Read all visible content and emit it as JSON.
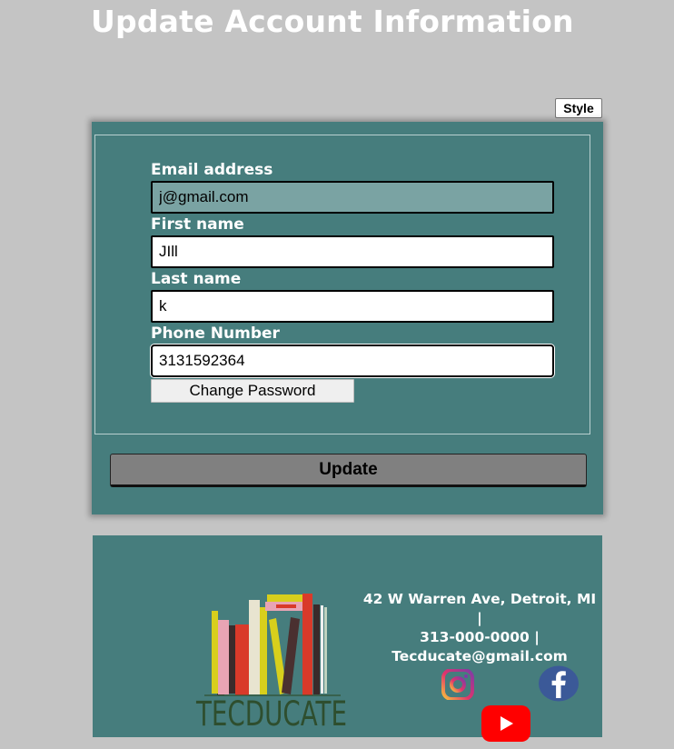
{
  "page": {
    "title": "Update Account Information"
  },
  "toolbar": {
    "style_label": "Style"
  },
  "form": {
    "email": {
      "label": "Email address",
      "value": "j@gmail.com"
    },
    "first_name": {
      "label": "First name",
      "value": "JIll"
    },
    "last_name": {
      "label": "Last name",
      "value": "k"
    },
    "phone": {
      "label": "Phone Number",
      "value": "3131592364"
    },
    "change_password_label": "Change Password",
    "update_label": "Update"
  },
  "footer": {
    "logo_text": "TECDUCATE",
    "address_line": "42 W Warren Ave, Detroit, MI |",
    "phone_line": "313-000-0000 |",
    "email_line": "Tecducate@gmail.com",
    "social": [
      "instagram-icon",
      "facebook-icon",
      "youtube-icon"
    ]
  },
  "colors": {
    "background": "#c4c4c4",
    "panel": "#467d7d",
    "readonly_input": "#7aa3a3",
    "update_button": "#808080",
    "logo_text": "#2e4e2e",
    "youtube": "#ff0000",
    "facebook": "#3b5998"
  }
}
